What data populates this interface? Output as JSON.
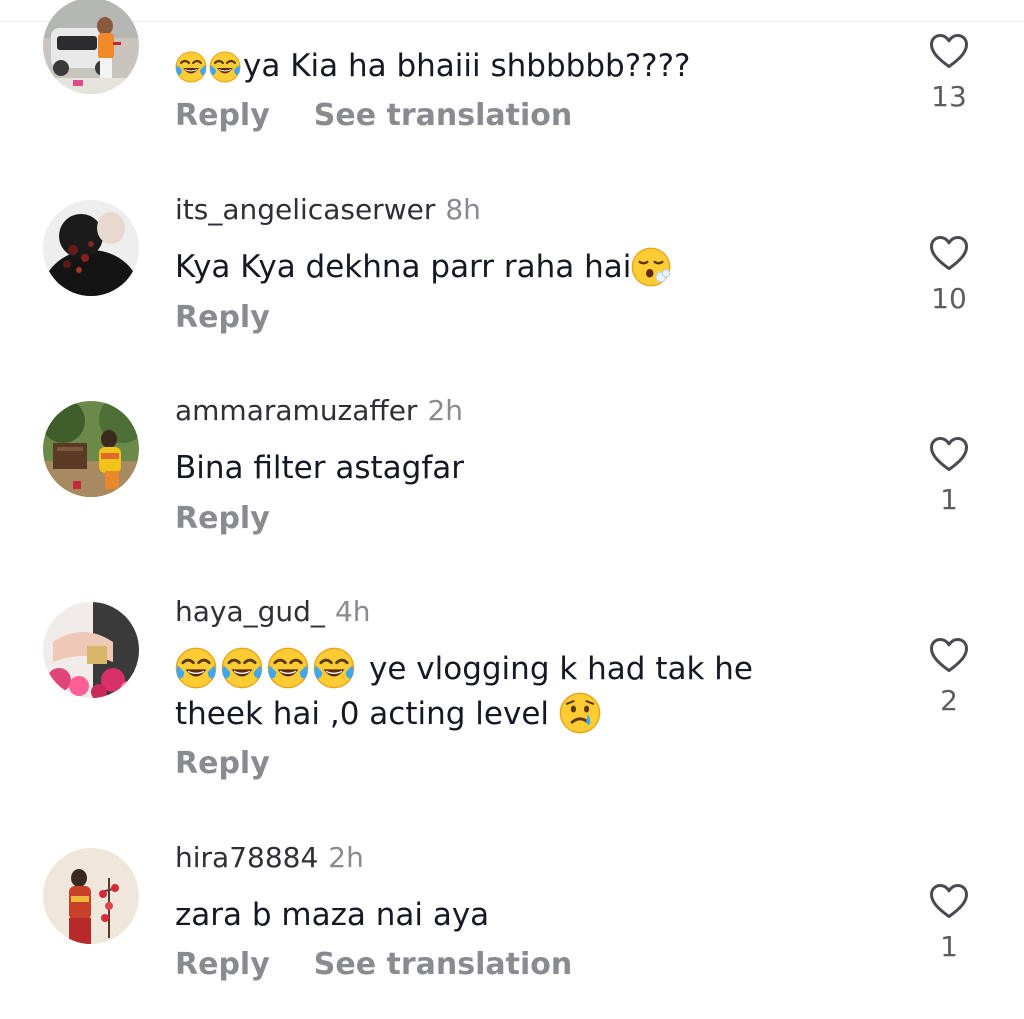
{
  "comments": [
    {
      "username": "",
      "time": "",
      "text": "ya Kia ha bhaiii shbbbbb????",
      "reply_label": "Reply",
      "translate_label": "See translation",
      "likes": "13",
      "emoji_prefix": [
        "face-with-tears-of-joy-icon",
        "face-with-tears-of-joy-icon"
      ]
    },
    {
      "username": "its_angelicaserwer",
      "time": "8h",
      "text": "Kya Kya dekhna parr raha hai",
      "reply_label": "Reply",
      "likes": "10",
      "emoji_suffix": [
        "face-exhaling-icon"
      ]
    },
    {
      "username": "ammaramuzaffer",
      "time": "2h",
      "text": "Bina filter astagfar",
      "reply_label": "Reply",
      "likes": "1"
    },
    {
      "username": "haya_gud_",
      "time": "4h",
      "text_line1": "ye vlogging k had tak he",
      "text_line2": "theek hai ,0 acting level",
      "reply_label": "Reply",
      "likes": "2",
      "emoji_prefix": [
        "face-with-tears-of-joy-icon",
        "face-with-tears-of-joy-icon",
        "face-with-tears-of-joy-icon",
        "face-with-tears-of-joy-icon"
      ],
      "emoji_suffix": [
        "crying-face-icon"
      ]
    },
    {
      "username": "hira78884",
      "time": "2h",
      "text": "zara b maza nai aya",
      "reply_label": "Reply",
      "translate_label": "See translation",
      "likes": "1"
    }
  ],
  "colors": {
    "text": "#161823",
    "secondary": "#8a8b91",
    "like_count": "#5c5d63",
    "heart_stroke": "#4a4b52"
  }
}
